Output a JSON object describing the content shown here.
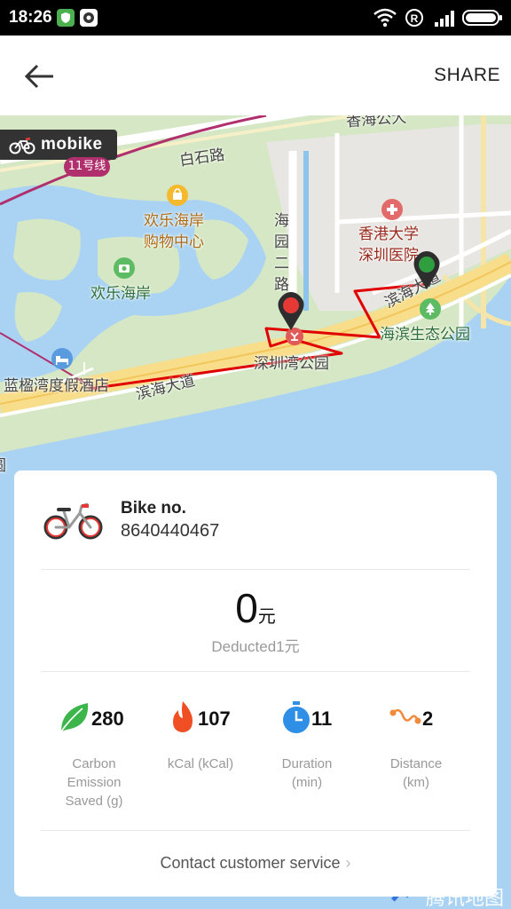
{
  "status_bar": {
    "time": "18:26",
    "icons": [
      "shield-icon",
      "app-icon",
      "wifi-icon",
      "registered-icon",
      "signal-icon",
      "battery-icon"
    ]
  },
  "app_bar": {
    "back_icon": "arrow-left-icon",
    "share_label": "SHARE"
  },
  "map": {
    "brand": "mobike",
    "metro_line": "11号线",
    "labels": {
      "baishi_road": "白石路",
      "haiyuan_road_1": "海",
      "haiyuan_road_2": "园",
      "haiyuan_road_3": "二",
      "haiyuan_road_4": "路",
      "top_road": "香海公大",
      "mall_1": "欢乐海岸",
      "mall_2": "购物中心",
      "happy_coast": "欢乐海岸",
      "hospital_1": "香港大学",
      "hospital_2": "深圳医院",
      "coastal_road_ne": "滨海大道",
      "eco_park": "海滨生态公园",
      "bay_park": "深圳湾公园",
      "hotel": "蓝楹湾度假酒店",
      "coastal_road_sw": "滨海大道",
      "edge_char": "圆"
    },
    "watermark": "腾讯地图",
    "colors": {
      "water": "#aad3f3",
      "land": "#d5e7c4",
      "route": "#e00000",
      "start_pin": "#e53935",
      "end_pin": "#2e9e3e"
    }
  },
  "trip_card": {
    "bike_label": "Bike no.",
    "bike_number": "8640440467",
    "amount": "0",
    "amount_unit": "元",
    "deducted_prefix": "Deducted1",
    "deducted_unit": "元",
    "stats": [
      {
        "icon": "leaf-icon",
        "value": "280",
        "label_lines": [
          "Carbon",
          "Emission",
          "Saved (g)"
        ],
        "color": "#3cb54a"
      },
      {
        "icon": "flame-icon",
        "value": "107",
        "label_lines": [
          "kCal (kCal)"
        ],
        "color": "#f04e23"
      },
      {
        "icon": "stopwatch-icon",
        "value": "11",
        "label_lines": [
          "Duration",
          "(min)"
        ],
        "color": "#2f8fe6"
      },
      {
        "icon": "route-icon",
        "value": "2",
        "label_lines": [
          "Distance",
          "(km)"
        ],
        "color": "#f28a3c"
      }
    ],
    "contact_label": "Contact customer service"
  }
}
